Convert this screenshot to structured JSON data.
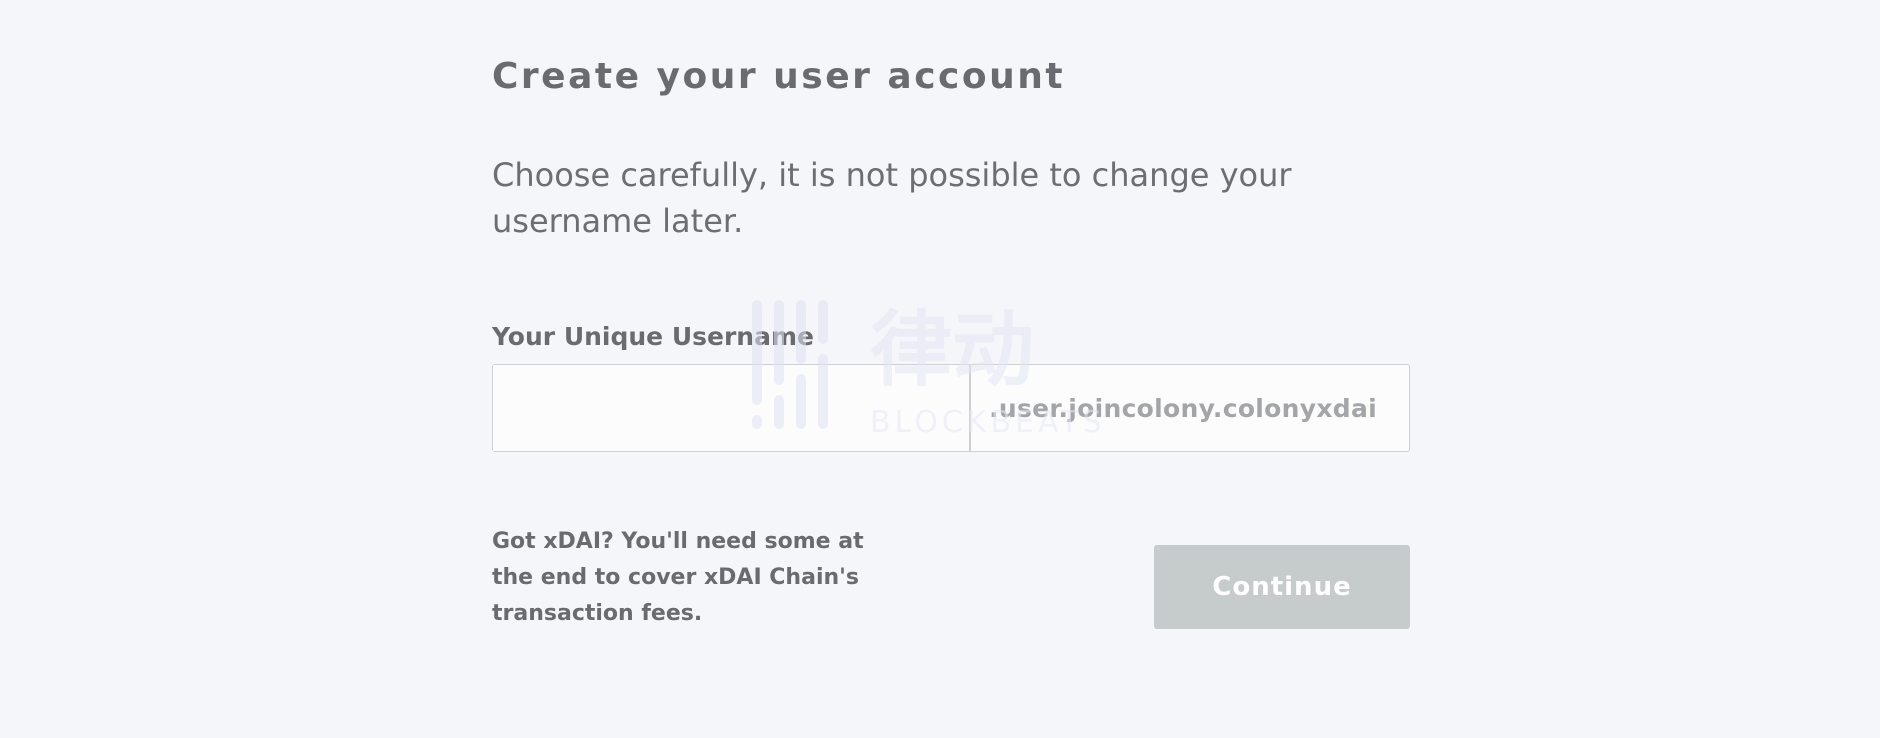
{
  "header": {
    "title": "Create your user account"
  },
  "intro": {
    "text": "Choose carefully, it is not possible to change your username later."
  },
  "username_field": {
    "label": "Your Unique Username",
    "value": "",
    "placeholder": "",
    "suffix": ".user.joincolony.colonyxdai"
  },
  "footer": {
    "note": "Got xDAI? You'll need some at the end to cover xDAI Chain's transaction fees.",
    "continue_label": "Continue",
    "continue_disabled": true
  },
  "watermark": {
    "icon": "blockbeats-logo",
    "text": "律动",
    "subtext": "BLOCKBEATS"
  },
  "colors": {
    "background": "#f5f6fa",
    "text": "#6a6b70",
    "suffix_text": "#a4a5a9",
    "button_disabled_bg": "#c5cccb",
    "button_text": "#ffffff",
    "border": "#cfd0d4"
  }
}
